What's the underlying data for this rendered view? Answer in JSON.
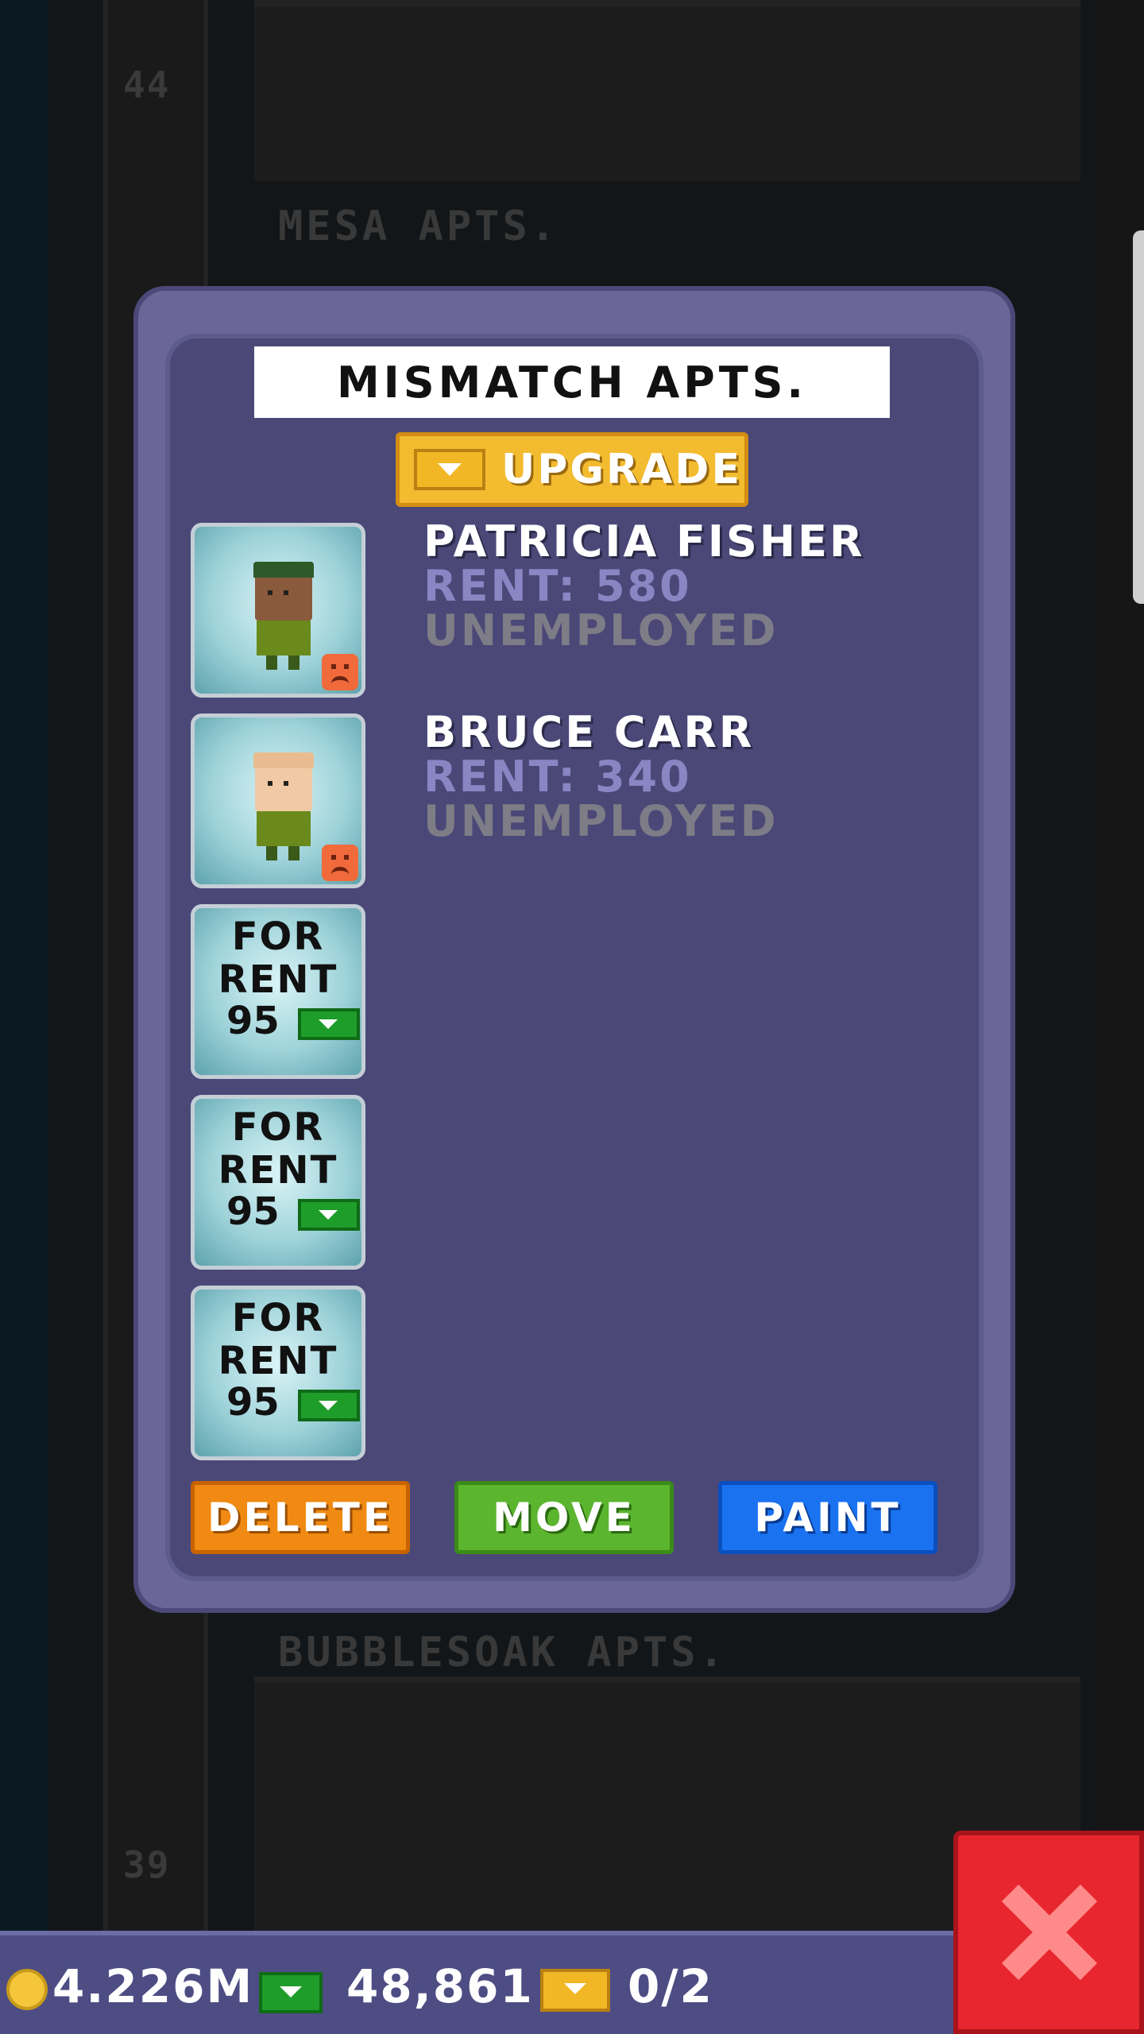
{
  "background": {
    "top_floor_number": "44",
    "top_floor_name": "MESA APTS.",
    "lower_floor_name": "BUBBLESOAK APTS.",
    "lower_floor_number": "39"
  },
  "dialog": {
    "title": "MISMATCH APTS.",
    "upgrade_label": "UPGRADE",
    "tenants": [
      {
        "name": "PATRICIA FISHER",
        "rent": "RENT: 580",
        "job": "UNEMPLOYED",
        "skin": "#8a5a3c",
        "hair": "#2e5a2a",
        "mood": "unhappy"
      },
      {
        "name": "BRUCE CARR",
        "rent": "RENT: 340",
        "job": "UNEMPLOYED",
        "skin": "#f1c9a5",
        "hair": "#f1c9a5",
        "mood": "unhappy"
      }
    ],
    "vacancies": [
      {
        "line1": "FOR",
        "line2": "RENT",
        "price": "95"
      },
      {
        "line1": "FOR",
        "line2": "RENT",
        "price": "95"
      },
      {
        "line1": "FOR",
        "line2": "RENT",
        "price": "95"
      }
    ],
    "actions": {
      "delete": "DELETE",
      "move": "MOVE",
      "paint": "PAINT"
    }
  },
  "status_bar": {
    "coins": "4.226M",
    "cash": "48,861",
    "bux": "0/2"
  },
  "colors": {
    "modal": "#6a6698",
    "upgrade": "#f3bb2f",
    "delete": "#f08a12",
    "move": "#5cb52e",
    "paint": "#1a72f0",
    "close": "#e8262f"
  },
  "icons": [
    "gold-bux-icon",
    "cash-icon",
    "coin-icon",
    "sad-face-icon",
    "close-icon"
  ]
}
